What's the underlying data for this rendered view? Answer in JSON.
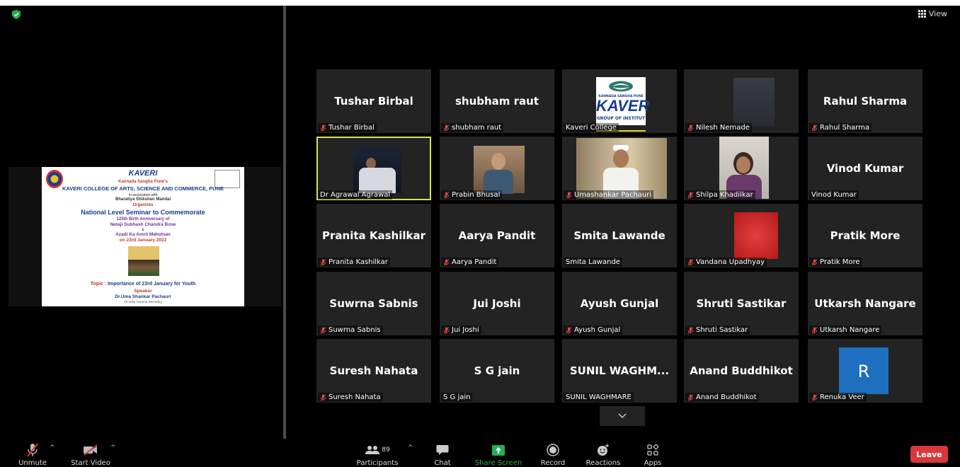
{
  "header": {
    "view_label": "View"
  },
  "slide": {
    "college_short": "KAVERI",
    "line1": "Kannada Sangha Pune's",
    "line2": "KAVERI COLLEGE OF ARTS, SCIENCE AND COMMERCE, PUNE",
    "line3": "In association with",
    "line4": "Bharatiya Shikshan Mandal",
    "line5": "Organizes",
    "line6": "National Level Seminar to Commemorate",
    "line7": "125th Birth Anniversary of",
    "line8": "Netaji Subhash Chandra Bose",
    "line9": "&",
    "line10": "Azadi Ka Amrit Mahotsav",
    "line11": "on 23rd January 2022",
    "topic_label": "Topic :",
    "topic": "Importance of 23rd January for Youth",
    "speaker_label": "Speaker",
    "speaker": "Dr.Uma Shankar Pachauri",
    "speaker_role": "All India General Secretary"
  },
  "participants": [
    {
      "display": "Tushar Birbal",
      "label": "Tushar Birbal",
      "muted": true
    },
    {
      "display": "shubham raut",
      "label": "shubham raut",
      "muted": true
    },
    {
      "display": "",
      "label": "Kaveri College",
      "muted": false
    },
    {
      "display": "",
      "label": "Nilesh Nemade",
      "muted": true
    },
    {
      "display": "Rahul Sharma",
      "label": "Rahul Sharma",
      "muted": true
    },
    {
      "display": "",
      "label": "Dr Agrawal Agrawal",
      "muted": false
    },
    {
      "display": "",
      "label": "Prabin Bhusal",
      "muted": true
    },
    {
      "display": "",
      "label": "Umashankar Pachauri",
      "muted": true
    },
    {
      "display": "",
      "label": "Shilpa Khadilkar",
      "muted": true
    },
    {
      "display": "Vinod Kumar",
      "label": "Vinod Kumar",
      "muted": false
    },
    {
      "display": "Pranita Kashilkar",
      "label": "Pranita Kashilkar",
      "muted": true
    },
    {
      "display": "Aarya Pandit",
      "label": "Aarya Pandit",
      "muted": true
    },
    {
      "display": "Smita Lawande",
      "label": "Smita Lawande",
      "muted": false
    },
    {
      "display": "",
      "label": "Vandana Upadhyay",
      "muted": true
    },
    {
      "display": "Pratik More",
      "label": "Pratik More",
      "muted": true
    },
    {
      "display": "Suwrna Sabnis",
      "label": "Suwrna Sabnis",
      "muted": true
    },
    {
      "display": "Jui Joshi",
      "label": "Jui Joshi",
      "muted": true
    },
    {
      "display": "Ayush Gunjal",
      "label": "Ayush Gunjal",
      "muted": true
    },
    {
      "display": "Shruti Sastikar",
      "label": "Shruti Sastikar",
      "muted": true
    },
    {
      "display": "Utkarsh Nangare",
      "label": "Utkarsh Nangare",
      "muted": true
    },
    {
      "display": "Suresh Nahata",
      "label": "Suresh Nahata",
      "muted": true
    },
    {
      "display": "S G jain",
      "label": "S G jain",
      "muted": false
    },
    {
      "display": "SUNIL WAGHM...",
      "label": "SUNIL WAGHMARE",
      "muted": false
    },
    {
      "display": "Anand Buddhikot",
      "label": "Anand Buddhikot",
      "muted": true
    },
    {
      "display": "R",
      "label": "Renuka Veer",
      "muted": true
    }
  ],
  "kaveri_logo_text": "KAVER",
  "kaveri_logo_sub": "GROUP OF INSTITUT",
  "kaveri_logo_top": "KANNADA SANGHA PUNE",
  "toolbar": {
    "unmute": "Unmute",
    "start_video": "Start Video",
    "participants": "Participants",
    "participants_count": "89",
    "chat": "Chat",
    "share_screen": "Share Screen",
    "record": "Record",
    "reactions": "Reactions",
    "apps": "Apps",
    "leave": "Leave"
  },
  "colors": {
    "active_speaker": "#d7e35b",
    "share_green": "#22b14c",
    "leave_red": "#d9383a",
    "avatar_blue": "#1e6fbf"
  }
}
